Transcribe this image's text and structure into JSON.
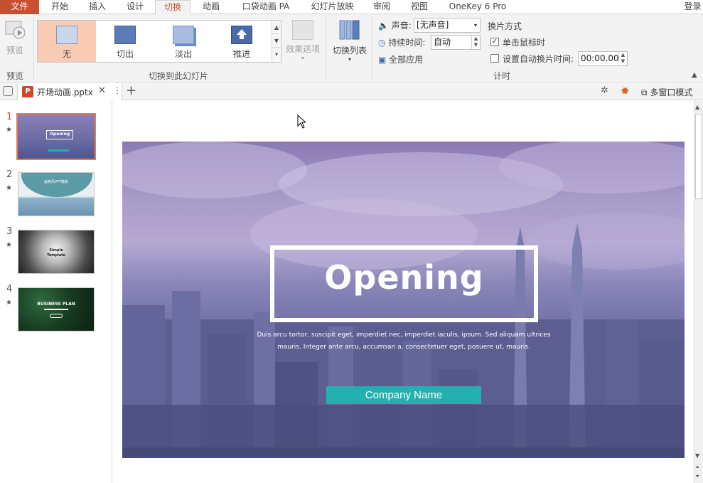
{
  "menu": {
    "file": "文件",
    "tabs": [
      "开始",
      "插入",
      "设计",
      "切换",
      "动画",
      "口袋动画 PA",
      "幻灯片放映",
      "审阅",
      "视图",
      "OneKey 6 Pro"
    ],
    "login": "登录"
  },
  "ribbon": {
    "preview_button": "预览",
    "preview_group": "预览",
    "gallery": [
      "无",
      "切出",
      "淡出",
      "推进"
    ],
    "effect_options": "效果选项",
    "transition_group": "切换到此幻灯片",
    "switch_list": "切换列表",
    "sound_label": "声音:",
    "sound_value": "[无声音]",
    "duration_label": "持续时间:",
    "duration_value": "自动",
    "apply_all": "全部应用",
    "advance_title": "换片方式",
    "on_click": "单击鼠标时",
    "auto_advance": "设置自动换片时间:",
    "auto_time": "00:00.00",
    "timing_group": "计时"
  },
  "doc": {
    "filename": "开场动画.pptx",
    "ppt_badge": "P",
    "multi_window": "多窗口模式"
  },
  "thumbnails": {
    "numbers": [
      "1",
      "2",
      "3",
      "4"
    ],
    "star": "★",
    "t1_title": "Opening",
    "t2_title": "画意风PPT模板",
    "t3_line1": "Simple",
    "t3_line2": "Template",
    "t4_title": "BUSINESS PLAN"
  },
  "slide": {
    "title": "Opening",
    "body": "Duis arcu tortor, suscipit eget, imperdiet nec, imperdiet iaculis, ipsum. Sed aliquam ultrices mauris. Integer ante arcu, accumsan a, consectetuer eget, posuere ut, mauris.",
    "company": "Company Name"
  },
  "colors": {
    "accent": "#c75032",
    "selected_tile": "#f9cbb5",
    "company_bar": "#24b0ae"
  }
}
